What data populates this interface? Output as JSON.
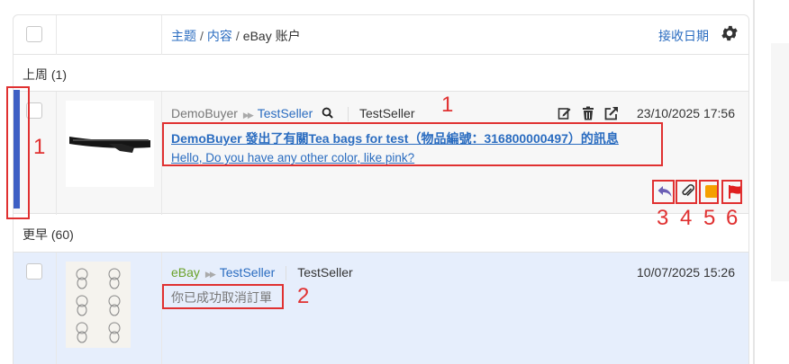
{
  "header": {
    "crumb_subject": "主题",
    "crumb_content": "内容",
    "crumb_account": "eBay 账户",
    "sort_label": "接收日期",
    "sep": "/"
  },
  "sections": {
    "last_week": "上周 (1)",
    "earlier": "更早 (60)"
  },
  "messages": [
    {
      "from": "DemoBuyer",
      "to": "TestSeller",
      "account": "TestSeller",
      "subject": "DemoBuyer 發出了有關Tea bags for test（物品編號：316800000497）的訊息",
      "preview": "Hello, Do you have any other color, like pink?",
      "date": "23/10/2025 17:56",
      "thumb": "wiper-blade-image"
    },
    {
      "from": "eBay",
      "to": "TestSeller",
      "account": "TestSeller",
      "subject": "你已成功取消訂單",
      "date": "10/07/2025 15:26",
      "thumb": "bear-stickers-image"
    }
  ],
  "annotations": {
    "n1": "1",
    "n2": "2",
    "n3": "3",
    "n4": "4",
    "n5": "5",
    "n6": "6"
  },
  "colors": {
    "link": "#2a6cc0",
    "ebay_green": "#6aa12a",
    "annotation_red": "#e03131",
    "selected_row": "#e6eefc",
    "flag_red": "#e02020",
    "tag_orange": "#f5a000",
    "reply_purple": "#6b5fb5"
  }
}
